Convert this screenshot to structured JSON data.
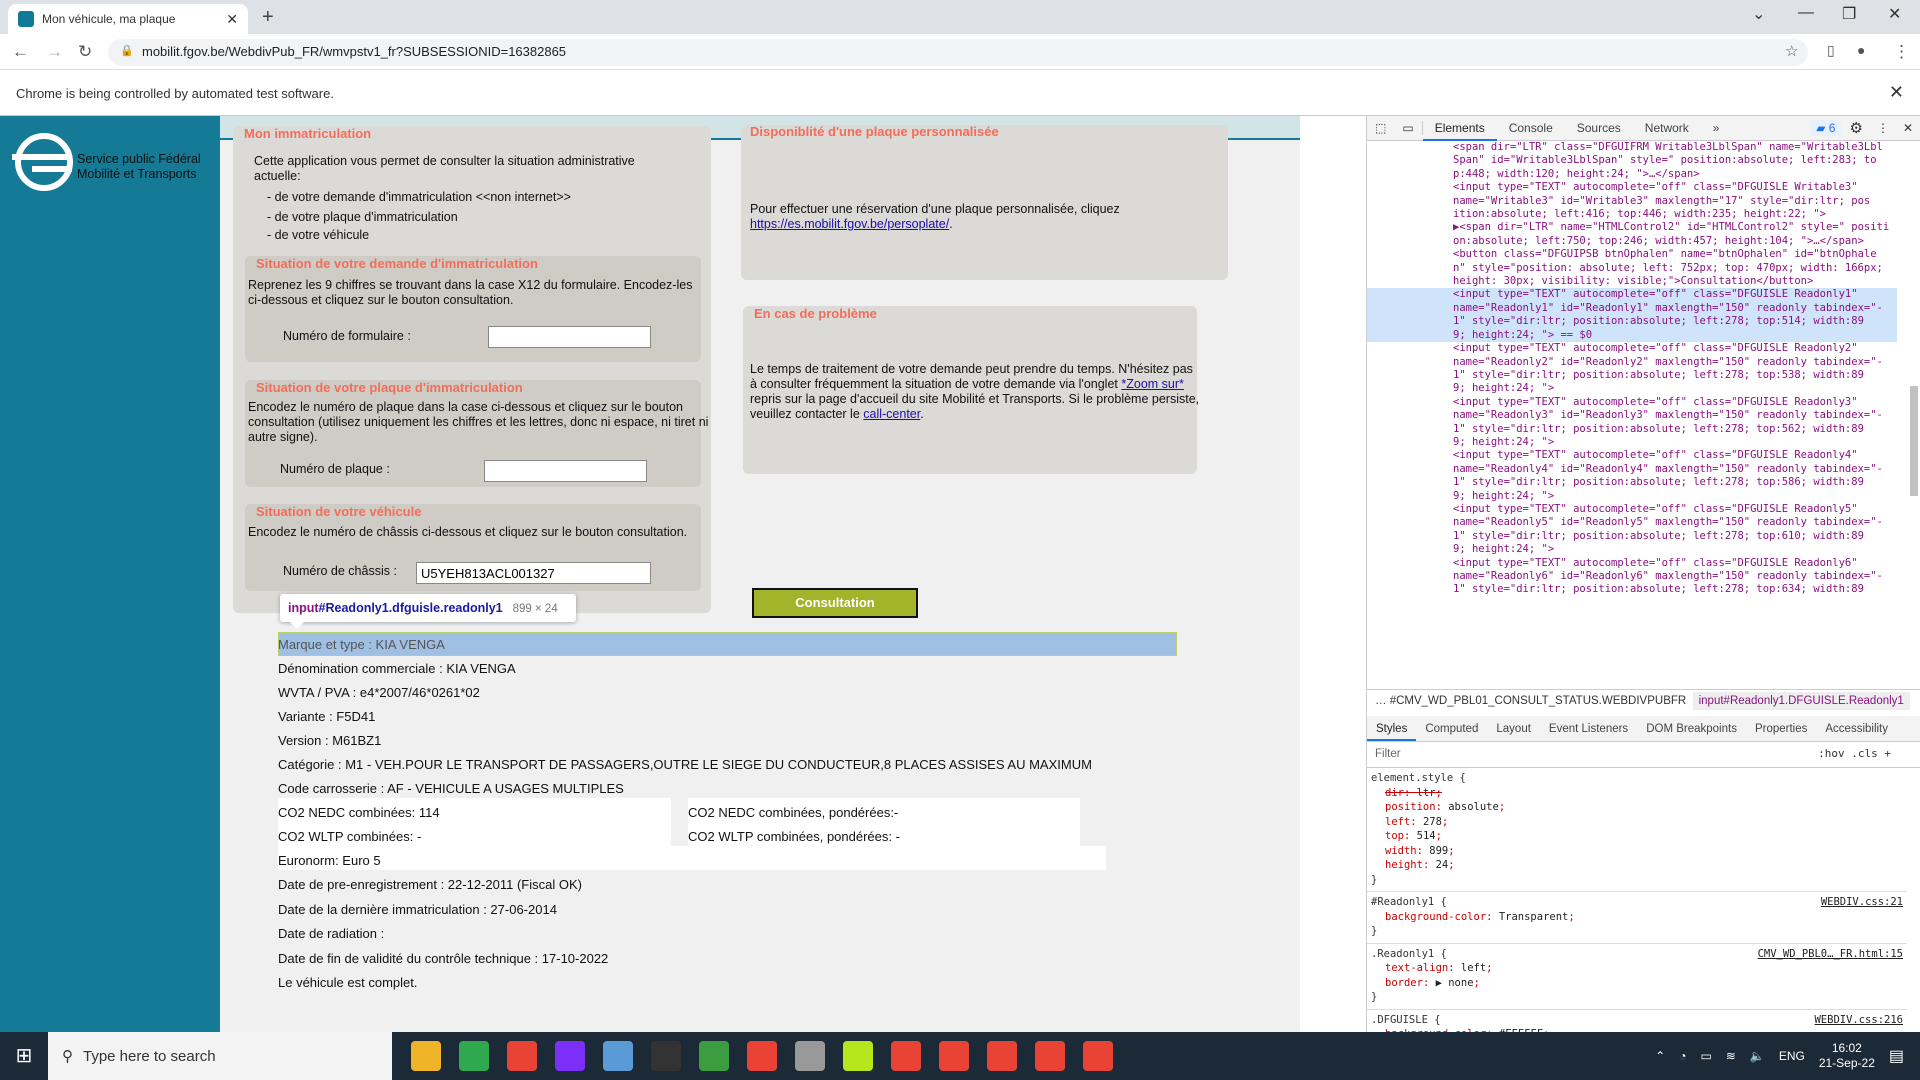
{
  "browser": {
    "tab_title": "Mon véhicule, ma plaque",
    "url": "mobilit.fgov.be/WebdivPub_FR/wmvpstv1_fr?SUBSESSIONID=16382865",
    "infobar": "Chrome is being controlled by automated test software."
  },
  "logo": {
    "line1": "Service public Fédéral",
    "line2": "Mobilité et Transports"
  },
  "left_panel": {
    "title": "Mon immatriculation",
    "intro": "Cette application vous permet de consulter la situation administrative actuelle:",
    "bullets": [
      "- de votre demande d'immatriculation <<non internet>>",
      "- de votre plaque d'immatriculation",
      "- de votre véhicule"
    ],
    "sections": [
      {
        "title": "Situation de votre demande d'immatriculation",
        "text": "Reprenez les 9 chiffres se trouvant dans la case X12 du formulaire. Encodez-les ci-dessous et cliquez sur le bouton consultation.",
        "label": "Numéro de formulaire :",
        "value": ""
      },
      {
        "title": "Situation de votre plaque d'immatriculation",
        "text": "Encodez le numéro de plaque dans la case ci-dessous et cliquez sur le bouton consultation (utilisez uniquement les chiffres et les lettres, donc ni espace, ni tiret ni autre signe).",
        "label": "Numéro de plaque :",
        "value": ""
      },
      {
        "title": "Situation de votre véhicule",
        "text": "Encodez le numéro de châssis ci-dessous et cliquez sur le bouton consultation.",
        "label": "Numéro de châssis :",
        "value": "U5YEH813ACL001327"
      }
    ]
  },
  "right_panels": {
    "perso": {
      "title": "Disponiblité d'une plaque personnalisée",
      "text": "Pour effectuer une réservation d'une plaque personnalisée, cliquez",
      "link": "https://es.mobilit.fgov.be/persoplate/",
      "after": "."
    },
    "probleme": {
      "title": "En cas de problème",
      "text1": "Le temps de traitement de votre demande peut prendre du temps. N'hésitez pas à consulter fréquemment la situation de votre demande via l'onglet",
      "link1": "*Zoom sur*",
      "text2": "repris sur la page d'accueil du site Mobilité et Transports. Si le problème persiste, veuillez contacter le",
      "link2": "call-center",
      "after": "."
    }
  },
  "consultation_button": "Consultation",
  "tooltip": {
    "tag": "input",
    "selector": "#Readonly1.dfguisle.readonly1",
    "size": "899 × 24"
  },
  "results": {
    "rows": [
      "Marque et type : KIA VENGA",
      "Dénomination commerciale : KIA VENGA",
      "WVTA / PVA : e4*2007/46*0261*02",
      "Variante : F5D41",
      "Version : M61BZ1",
      "Catégorie : M1 - VEH.POUR LE TRANSPORT DE PASSAGERS,OUTRE LE SIEGE DU CONDUCTEUR,8 PLACES ASSISES AU MAXIMUM",
      "Code carrosserie : AF - VEHICULE A USAGES MULTIPLES"
    ],
    "co2_left": [
      "CO2 NEDC combinées: 114",
      "CO2 WLTP combinées: -"
    ],
    "co2_right": [
      "CO2 NEDC combinées, pondérées:-",
      "CO2 WLTP combinées, pondérées: -"
    ],
    "euronorm": "Euronorm: Euro 5",
    "dates": [
      "Date de pre-enregistrement : 22-12-2011 (Fiscal OK)",
      "Date de la dernière immatriculation : 27-06-2014",
      "Date de radiation :",
      "Date de fin de validité du contrôle technique : 17-10-2022",
      "Le véhicule est complet."
    ]
  },
  "devtools": {
    "tabs": [
      "Elements",
      "Console",
      "Sources",
      "Network",
      "»"
    ],
    "issues": "6",
    "code": [
      "<span dir=\"LTR\" class=\"DFGUIFRM Writable3LblSpan\" name=\"Writable3Lbl",
      "Span\" id=\"Writable3LblSpan\" style=\" position:absolute; left:283; to",
      "p:448; width:120; height:24; \">…</span>",
      "<input type=\"TEXT\" autocomplete=\"off\" class=\"DFGUISLE Writable3\"",
      "name=\"Writable3\" id=\"Writable3\" maxlength=\"17\" style=\"dir:ltr;   pos",
      "ition:absolute; left:416; top:446; width:235; height:22;  \">",
      "▶<span dir=\"LTR\" name=\"HTMLControl2\" id=\"HTMLControl2\" style=\" positi",
      "on:absolute; left:750; top:246; width:457; height:104; \">…</span>",
      "<button class=\"DFGUIPSB btnOphalen\" name=\"btnOphalen\" id=\"btnOphale",
      "n\" style=\"position: absolute; left: 752px; top: 470px; width: 166px;",
      "height: 30px; visibility: visible;\">Consultation</button>",
      "<input type=\"TEXT\" autocomplete=\"off\" class=\"DFGUISLE Readonly1\"",
      "name=\"Readonly1\" id=\"Readonly1\" maxlength=\"150\" readonly tabindex=\"-",
      "1\" style=\"dir:ltr;   position:absolute; left:278; top:514; width:89",
      "9; height:24;  \"> == $0",
      "<input type=\"TEXT\" autocomplete=\"off\" class=\"DFGUISLE Readonly2\"",
      "name=\"Readonly2\" id=\"Readonly2\" maxlength=\"150\" readonly tabindex=\"-",
      "1\" style=\"dir:ltr;   position:absolute; left:278; top:538; width:89",
      "9; height:24;  \">",
      "<input type=\"TEXT\" autocomplete=\"off\" class=\"DFGUISLE Readonly3\"",
      "name=\"Readonly3\" id=\"Readonly3\" maxlength=\"150\" readonly tabindex=\"-",
      "1\" style=\"dir:ltr;   position:absolute; left:278; top:562; width:89",
      "9; height:24;  \">",
      "<input type=\"TEXT\" autocomplete=\"off\" class=\"DFGUISLE Readonly4\"",
      "name=\"Readonly4\" id=\"Readonly4\" maxlength=\"150\" readonly tabindex=\"-",
      "1\" style=\"dir:ltr;   position:absolute; left:278; top:586; width:89",
      "9; height:24;  \">",
      "<input type=\"TEXT\" autocomplete=\"off\" class=\"DFGUISLE Readonly5\"",
      "name=\"Readonly5\" id=\"Readonly5\" maxlength=\"150\" readonly tabindex=\"-",
      "1\" style=\"dir:ltr;   position:absolute; left:278; top:610; width:89",
      "9; height:24;  \">",
      "<input type=\"TEXT\" autocomplete=\"off\" class=\"DFGUISLE Readonly6\"",
      "name=\"Readonly6\" id=\"Readonly6\" maxlength=\"150\" readonly tabindex=\"-",
      "1\" style=\"dir:ltr;   position:absolute; left:278; top:634; width:89"
    ],
    "crumb1": "… #CMV_WD_PBL01_CONSULT_STATUS.WEBDIVPUBFR",
    "crumb2": "input#Readonly1.DFGUISLE.Readonly1",
    "style_tabs": [
      "Styles",
      "Computed",
      "Layout",
      "Event Listeners",
      "DOM Breakpoints",
      "Properties",
      "Accessibility"
    ],
    "filter_placeholder": "Filter",
    "filter_tools": ":hov  .cls  +",
    "rules": [
      {
        "selector": "element.style {",
        "source": "",
        "props": [
          [
            "dir",
            "ltr"
          ],
          [
            "position",
            "absolute"
          ],
          [
            "left",
            "278"
          ],
          [
            "top",
            "514"
          ],
          [
            "width",
            "899"
          ],
          [
            "height",
            "24"
          ]
        ]
      },
      {
        "selector": "#Readonly1 {",
        "source": "WEBDIV.css:21",
        "props": [
          [
            "background-color",
            "Transparent"
          ]
        ]
      },
      {
        "selector": ".Readonly1 {",
        "source": "CMV_WD_PBL0…_FR.html:15",
        "props": [
          [
            "text-align",
            "left"
          ],
          [
            "border",
            "▶ none"
          ]
        ]
      },
      {
        "selector": ".DFGUISLE {",
        "source": "WEBDIV.css:216",
        "props": [
          [
            "background-color",
            "#FFFFFF"
          ]
        ]
      }
    ]
  },
  "taskbar": {
    "search_placeholder": "Type here to search",
    "lang": "ENG",
    "time": "16:02",
    "date": "21-Sep-22"
  },
  "colors": {
    "brand": "#147a96",
    "section_title": "#f26e5a",
    "button": "#a3b42a",
    "highlight": "#9fc0e3"
  }
}
